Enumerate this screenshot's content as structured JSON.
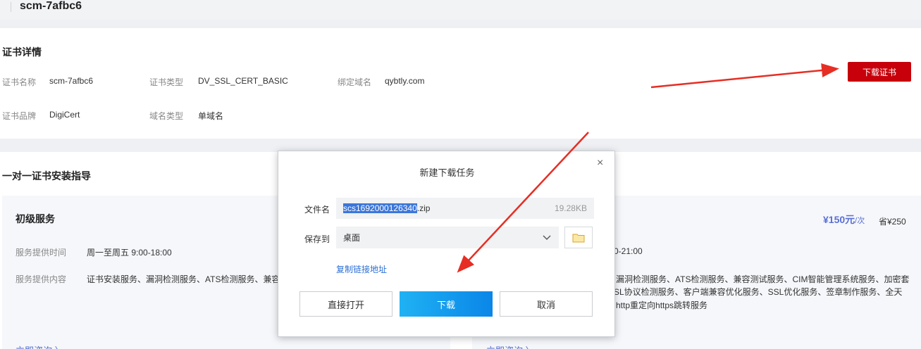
{
  "header": {
    "back_icon": "‹",
    "title": "scm-7afbc6"
  },
  "cert_details": {
    "title": "证书详情",
    "fields": [
      {
        "label": "证书名称",
        "value": "scm-7afbc6"
      },
      {
        "label": "证书类型",
        "value": "DV_SSL_CERT_BASIC"
      },
      {
        "label": "绑定域名",
        "value": "qybtly.com"
      },
      {
        "label": "证书品牌",
        "value": "DigiCert"
      },
      {
        "label": "域名类型",
        "value": "单域名"
      }
    ],
    "download_button": "下载证书",
    "accent_color": "#c7000b"
  },
  "guide": {
    "title": "一对一证书安装指导",
    "basic": {
      "title": "初级服务",
      "time_label": "服务提供时间",
      "time_value": "周一至周五 9:00-18:00",
      "content_label": "服务提供内容",
      "content_value": "证书安装服务、漏洞检测服务、ATS检测服务、兼容",
      "consult": "立即咨询 〉"
    },
    "advanced": {
      "price": "¥150元",
      "price_unit": "/次",
      "save": "省¥250",
      "time_value": "0-21:00",
      "content_lines": [
        "漏洞检测服务、ATS检测服务、兼容测试服务、CIM智能管理系统服务、加密套",
        "SL协议检测服务、客户端兼容优化服务、SSL优化服务、签章制作服务、全天",
        "http重定向https跳转服务"
      ],
      "consult": "立即咨询 〉"
    }
  },
  "dialog": {
    "title": "新建下载任务",
    "close_icon": "×",
    "filename_label": "文件名",
    "filename_selected": "scs1692000126340",
    "filename_ext": ".zip",
    "file_size": "19.28KB",
    "save_to_label": "保存到",
    "save_to_value": "桌面",
    "copy_link": "复制链接地址",
    "open_button": "直接打开",
    "download_button": "下载",
    "cancel_button": "取消"
  }
}
